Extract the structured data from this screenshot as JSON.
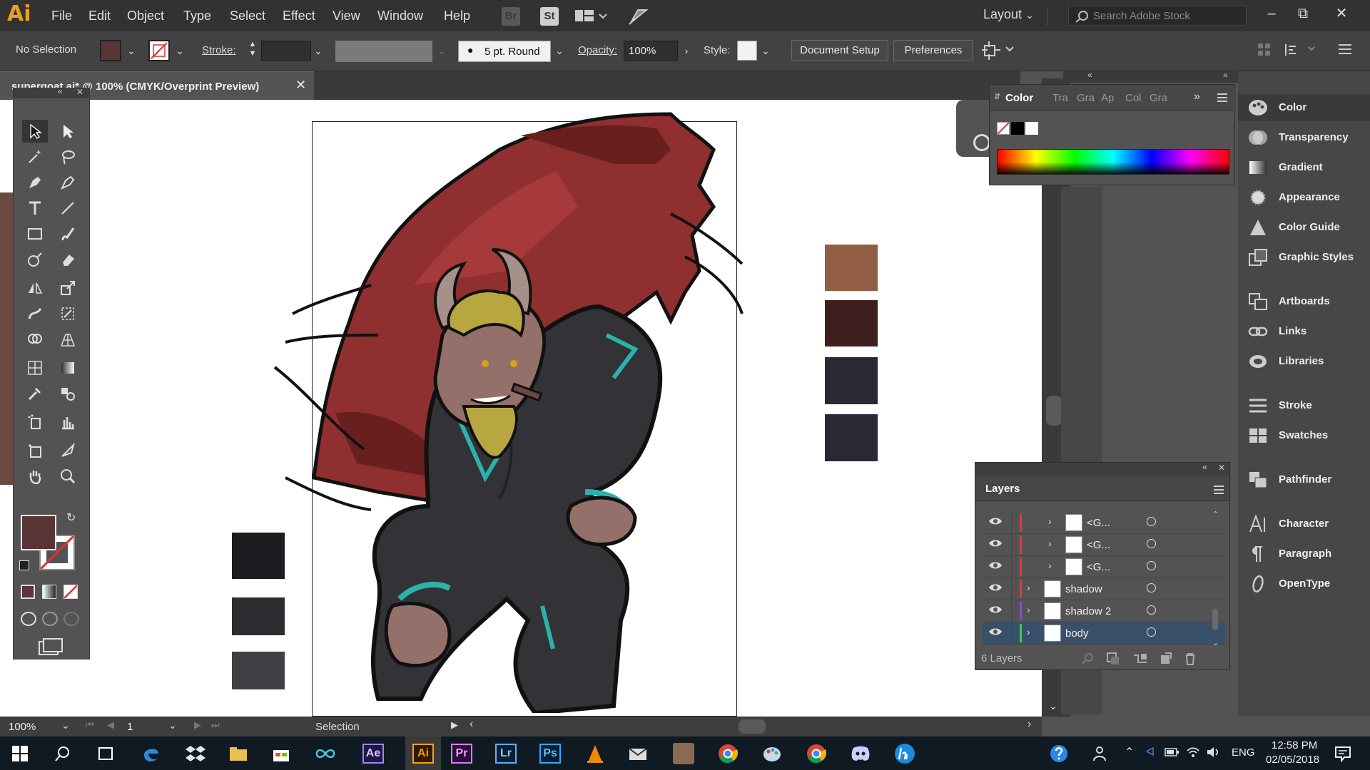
{
  "app": {
    "logo": "Ai"
  },
  "menu": {
    "items": [
      "File",
      "Edit",
      "Object",
      "Type",
      "Select",
      "Effect",
      "View",
      "Window",
      "Help"
    ]
  },
  "bridge": {
    "br": "Br",
    "st": "St"
  },
  "workspace": {
    "label": "Layout"
  },
  "search": {
    "placeholder": "Search Adobe Stock"
  },
  "control": {
    "selection": "No Selection",
    "stroke_label": "Stroke:",
    "brush": "5 pt. Round",
    "opacity_label": "Opacity:",
    "opacity_value": "100%",
    "style_label": "Style:",
    "doc_setup": "Document Setup",
    "preferences": "Preferences",
    "fill_color": "#5a3535"
  },
  "document": {
    "title": "supergoat.ai* @ 100% (CMYK/Overprint Preview)"
  },
  "status": {
    "zoom": "100%",
    "page": "1",
    "mode": "Selection"
  },
  "color_panel": {
    "tabs": [
      "Color",
      "Tra",
      "Gra",
      "Ap",
      "Col",
      "Gra"
    ],
    "active": "Color"
  },
  "dock": {
    "items": [
      "Color",
      "Transparency",
      "Gradient",
      "Appearance",
      "Color Guide",
      "Graphic Styles",
      "Artboards",
      "Links",
      "Libraries",
      "Stroke",
      "Swatches",
      "Pathfinder",
      "Character",
      "Paragraph",
      "OpenType"
    ],
    "icons": [
      "palette-icon",
      "transparency-icon",
      "gradient-icon",
      "appearance-icon",
      "color-guide-icon",
      "graphic-styles-icon",
      "artboards-icon",
      "links-icon",
      "libraries-icon",
      "stroke-icon",
      "swatches-icon",
      "pathfinder-icon",
      "character-icon",
      "paragraph-icon",
      "opentype-icon"
    ]
  },
  "layers": {
    "title": "Layers",
    "count": "6 Layers",
    "rows": [
      {
        "name": "<G...",
        "color": "#e03a3a"
      },
      {
        "name": "<G...",
        "color": "#e03a3a"
      },
      {
        "name": "<G...",
        "color": "#e03a3a"
      },
      {
        "name": "shadow",
        "color": "#e03a3a"
      },
      {
        "name": "shadow 2",
        "color": "#8a4ad8"
      },
      {
        "name": "body",
        "color": "#3ad04a"
      }
    ]
  },
  "swatches_right": [
    "#925e45",
    "#3e1f1d",
    "#2a2835",
    "#2a2835"
  ],
  "swatches_left": [
    "#1c1b20",
    "#2d2c31",
    "#3f3e43"
  ],
  "taskbar": {
    "time": "12:58 PM",
    "date": "02/05/2018",
    "lang": "ENG",
    "apps": [
      "Ae",
      "Ai",
      "Pr",
      "Lr",
      "Ps"
    ]
  }
}
